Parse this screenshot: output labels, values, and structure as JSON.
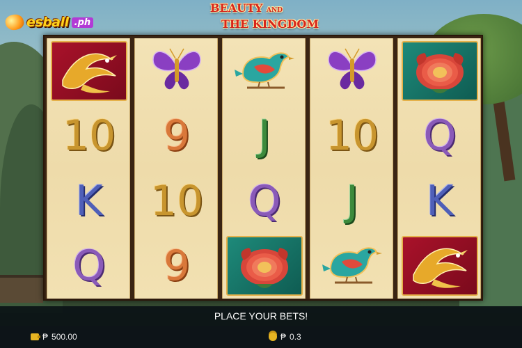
{
  "logo": {
    "brand": "esball",
    "suffix": ".ph"
  },
  "title": {
    "line1_a": "BEAUTY",
    "line1_b": "AND",
    "line2": "THE KINGDOM"
  },
  "reels": [
    [
      {
        "kind": "tile",
        "symbol": "phoenix-icon",
        "bg": "red"
      },
      {
        "kind": "letter",
        "text": "10",
        "color": "gold"
      },
      {
        "kind": "letter",
        "text": "K",
        "color": "blue"
      },
      {
        "kind": "letter",
        "text": "Q",
        "color": "purple"
      }
    ],
    [
      {
        "kind": "plain",
        "symbol": "butterfly-icon"
      },
      {
        "kind": "letter",
        "text": "9",
        "color": "orange"
      },
      {
        "kind": "letter",
        "text": "10",
        "color": "gold"
      },
      {
        "kind": "letter",
        "text": "9",
        "color": "orange"
      }
    ],
    [
      {
        "kind": "plain",
        "symbol": "bird-icon"
      },
      {
        "kind": "letter",
        "text": "J",
        "color": "green"
      },
      {
        "kind": "letter",
        "text": "Q",
        "color": "purple"
      },
      {
        "kind": "tile",
        "symbol": "peony-icon",
        "bg": "teal"
      }
    ],
    [
      {
        "kind": "plain",
        "symbol": "butterfly-icon"
      },
      {
        "kind": "letter",
        "text": "10",
        "color": "gold"
      },
      {
        "kind": "letter",
        "text": "J",
        "color": "green"
      },
      {
        "kind": "plain",
        "symbol": "bird-icon"
      }
    ],
    [
      {
        "kind": "tile",
        "symbol": "peony-icon",
        "bg": "teal"
      },
      {
        "kind": "letter",
        "text": "Q",
        "color": "purple"
      },
      {
        "kind": "letter",
        "text": "K",
        "color": "blue"
      },
      {
        "kind": "tile",
        "symbol": "phoenix-icon",
        "bg": "red"
      }
    ]
  ],
  "message": "PLACE YOUR BETS!",
  "balance": {
    "currency": "₱",
    "amount": "500.00"
  },
  "bet": {
    "currency": "₱",
    "amount": "0.3"
  },
  "colors": {
    "frame": "#3a2413",
    "reel_bg": "#f3e3b6",
    "title_red": "#d8251b"
  }
}
